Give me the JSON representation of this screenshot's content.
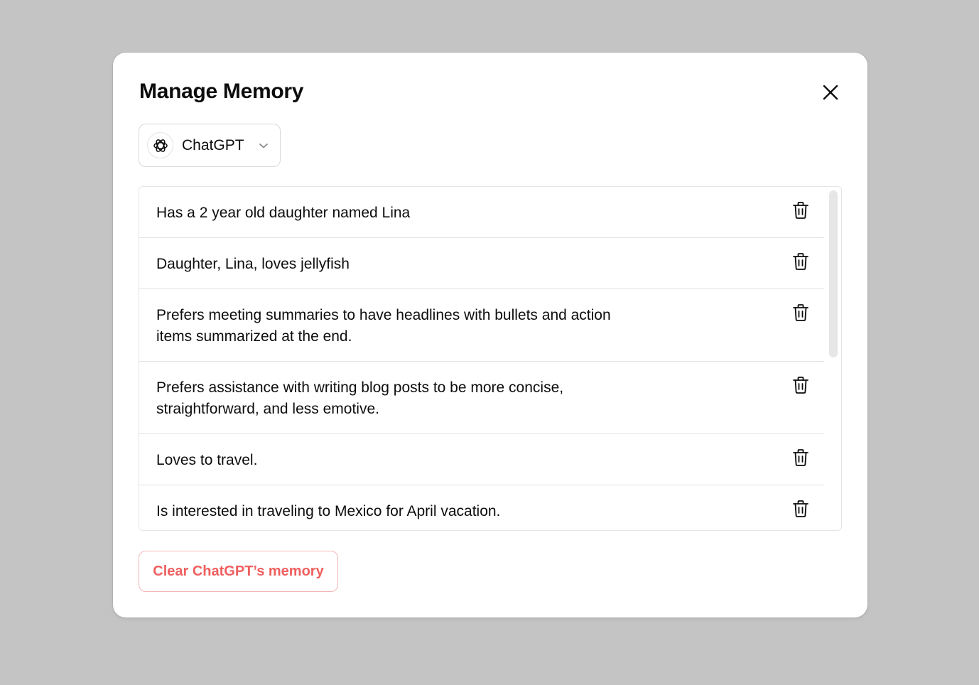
{
  "dialog": {
    "title": "Manage Memory",
    "close_icon": "close-icon"
  },
  "model_select": {
    "logo_icon": "openai-logo-icon",
    "selected": "ChatGPT",
    "chevron_icon": "chevron-down-icon"
  },
  "memories": [
    {
      "text": "Has a 2 year old daughter named Lina",
      "delete_icon": "trash-icon"
    },
    {
      "text": "Daughter, Lina, loves jellyfish",
      "delete_icon": "trash-icon"
    },
    {
      "text": "Prefers meeting summaries to have headlines with bullets and action items summarized at the end.",
      "delete_icon": "trash-icon"
    },
    {
      "text": "Prefers assistance with writing blog posts to be more concise, straightforward, and less emotive.",
      "delete_icon": "trash-icon"
    },
    {
      "text": "Loves to travel.",
      "delete_icon": "trash-icon"
    },
    {
      "text": "Is interested in traveling to Mexico for April vacation.",
      "delete_icon": "trash-icon"
    },
    {
      "text": "",
      "delete_icon": "trash-icon"
    }
  ],
  "clear_button": {
    "label": "Clear ChatGPT’s memory",
    "color": "#ef5f5f"
  },
  "colors": {
    "backdrop": "#c4c4c4",
    "dialog": "#ffffff",
    "danger": "#ef5f5f"
  }
}
